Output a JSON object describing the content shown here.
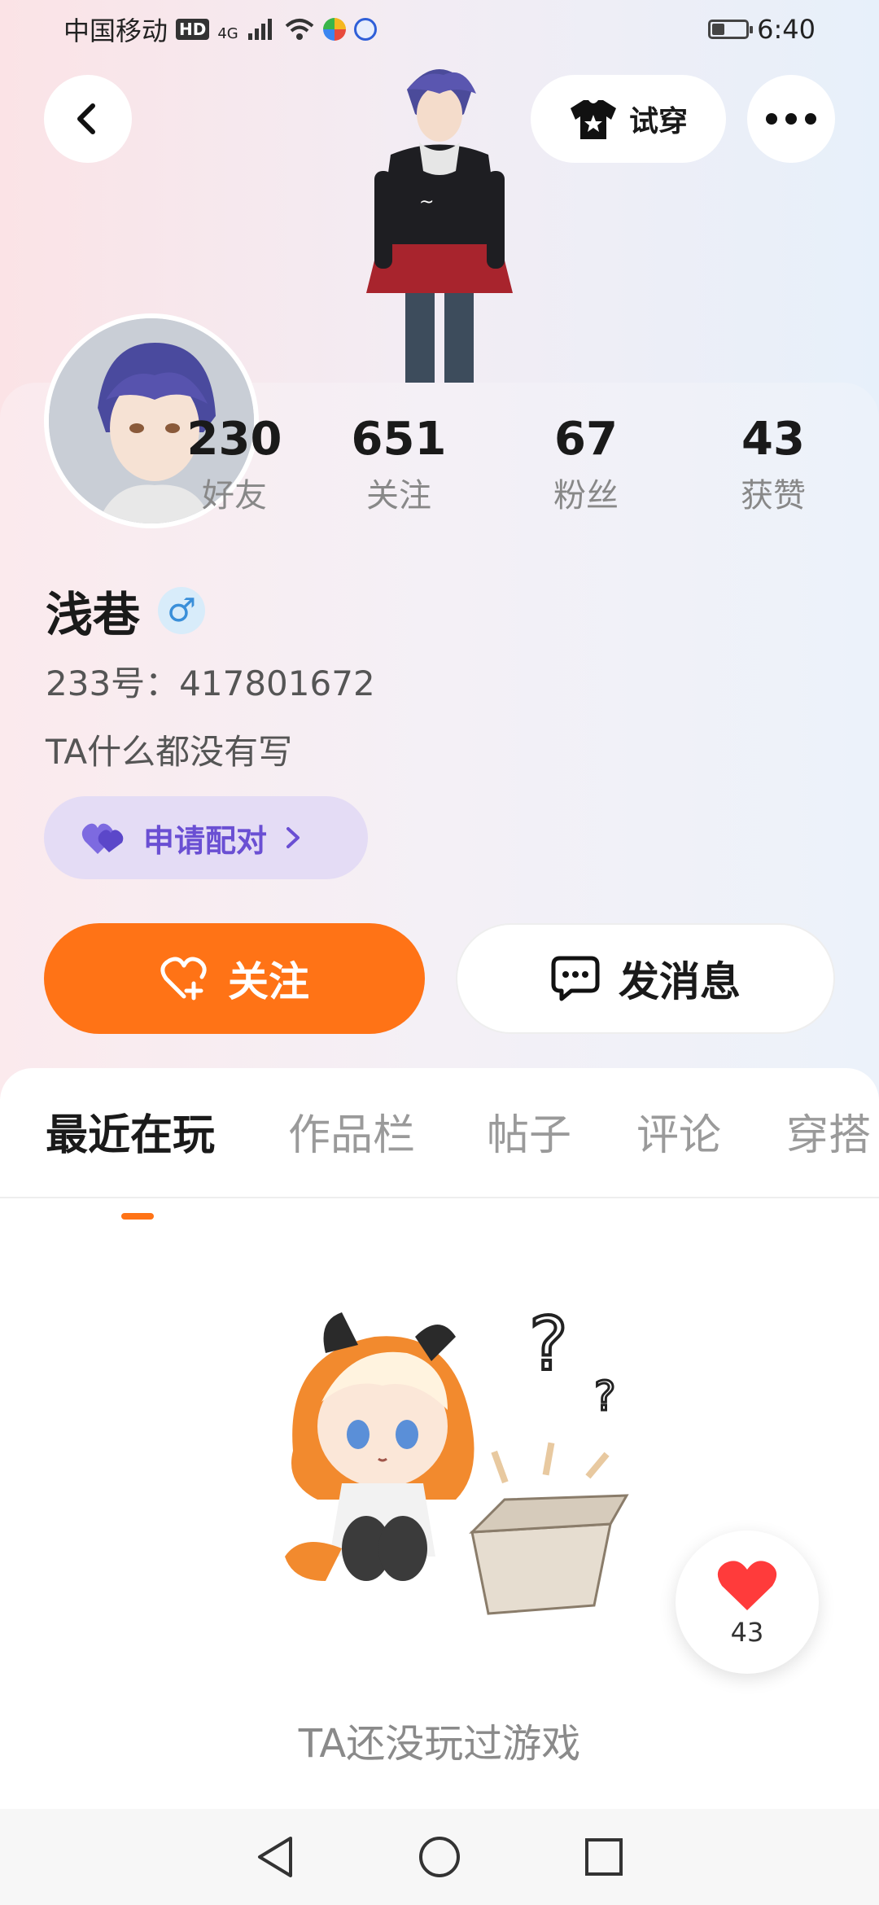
{
  "status_bar": {
    "carrier": "中国移动",
    "hd": "HD",
    "network": "4G",
    "battery_level": 0.35,
    "time": "6:40"
  },
  "header": {
    "back_icon": "chevron-left-icon",
    "tryon_label": "试穿",
    "more_icon": "more-dots-icon"
  },
  "profile": {
    "stats": [
      {
        "num": "230",
        "label": "好友"
      },
      {
        "num": "651",
        "label": "关注"
      },
      {
        "num": "67",
        "label": "粉丝"
      },
      {
        "num": "43",
        "label": "获赞"
      }
    ],
    "name": "浅巷",
    "gender_symbol": "♂",
    "uid": "233号：417801672",
    "bio": "TA什么都没有写",
    "pair_label": "申请配对",
    "follow_label": "关注",
    "message_label": "发消息"
  },
  "tabs": [
    {
      "label": "最近在玩",
      "active": true
    },
    {
      "label": "作品栏",
      "active": false
    },
    {
      "label": "帖子",
      "active": false
    },
    {
      "label": "评论",
      "active": false
    },
    {
      "label": "穿搭",
      "active": false
    }
  ],
  "empty_state": {
    "text": "TA还没玩过游戏"
  },
  "like_fab": {
    "count": "43"
  },
  "colors": {
    "accent": "#ff7316",
    "pair": "#6a4fd3",
    "pair_bg": "#e4dcf5",
    "gender": "#3a8fd9"
  }
}
